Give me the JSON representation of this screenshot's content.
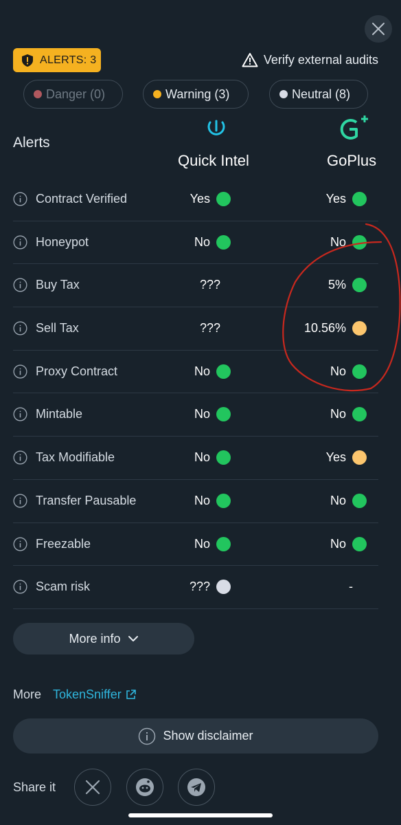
{
  "header": {
    "alerts_badge": "ALERTS: 3",
    "verify_link": "Verify external audits"
  },
  "filters": [
    {
      "label": "Danger (0)",
      "color": "#b0585e"
    },
    {
      "label": "Warning (3)",
      "color": "#f5b120"
    },
    {
      "label": "Neutral (8)",
      "color": "#d8dce6"
    }
  ],
  "table": {
    "title": "Alerts",
    "providers": [
      "Quick Intel",
      "GoPlus"
    ],
    "rows": [
      {
        "label": "Contract Verified",
        "qi": "Yes",
        "qi_status": "green",
        "gp": "Yes",
        "gp_status": "green"
      },
      {
        "label": "Honeypot",
        "qi": "No",
        "qi_status": "green",
        "gp": "No",
        "gp_status": "green"
      },
      {
        "label": "Buy Tax",
        "qi": "???",
        "qi_status": "none",
        "gp": "5%",
        "gp_status": "green"
      },
      {
        "label": "Sell Tax",
        "qi": "???",
        "qi_status": "none",
        "gp": "10.56%",
        "gp_status": "yellow"
      },
      {
        "label": "Proxy Contract",
        "qi": "No",
        "qi_status": "green",
        "gp": "No",
        "gp_status": "green"
      },
      {
        "label": "Mintable",
        "qi": "No",
        "qi_status": "green",
        "gp": "No",
        "gp_status": "green"
      },
      {
        "label": "Tax Modifiable",
        "qi": "No",
        "qi_status": "green",
        "gp": "Yes",
        "gp_status": "yellow"
      },
      {
        "label": "Transfer Pausable",
        "qi": "No",
        "qi_status": "green",
        "gp": "No",
        "gp_status": "green"
      },
      {
        "label": "Freezable",
        "qi": "No",
        "qi_status": "green",
        "gp": "No",
        "gp_status": "green"
      },
      {
        "label": "Scam risk",
        "qi": "???",
        "qi_status": "gray",
        "gp": "-",
        "gp_status": "none"
      }
    ]
  },
  "more_info_button": "More info",
  "more": {
    "label": "More",
    "link": "TokenSniffer"
  },
  "disclaimer_button": "Show disclaimer",
  "share_label": "Share it",
  "colors": {
    "green": "#22c55e",
    "yellow": "#fcc66e",
    "gray": "#d8dce6",
    "accent": "#f5b120",
    "link": "#2fb5dc",
    "annotation": "#c8281e"
  },
  "icons": [
    "close-icon",
    "shield-alert-icon",
    "warning-triangle-icon",
    "info-icon",
    "chevron-down-icon",
    "external-link-icon",
    "x-logo-icon",
    "reddit-icon",
    "telegram-icon"
  ]
}
